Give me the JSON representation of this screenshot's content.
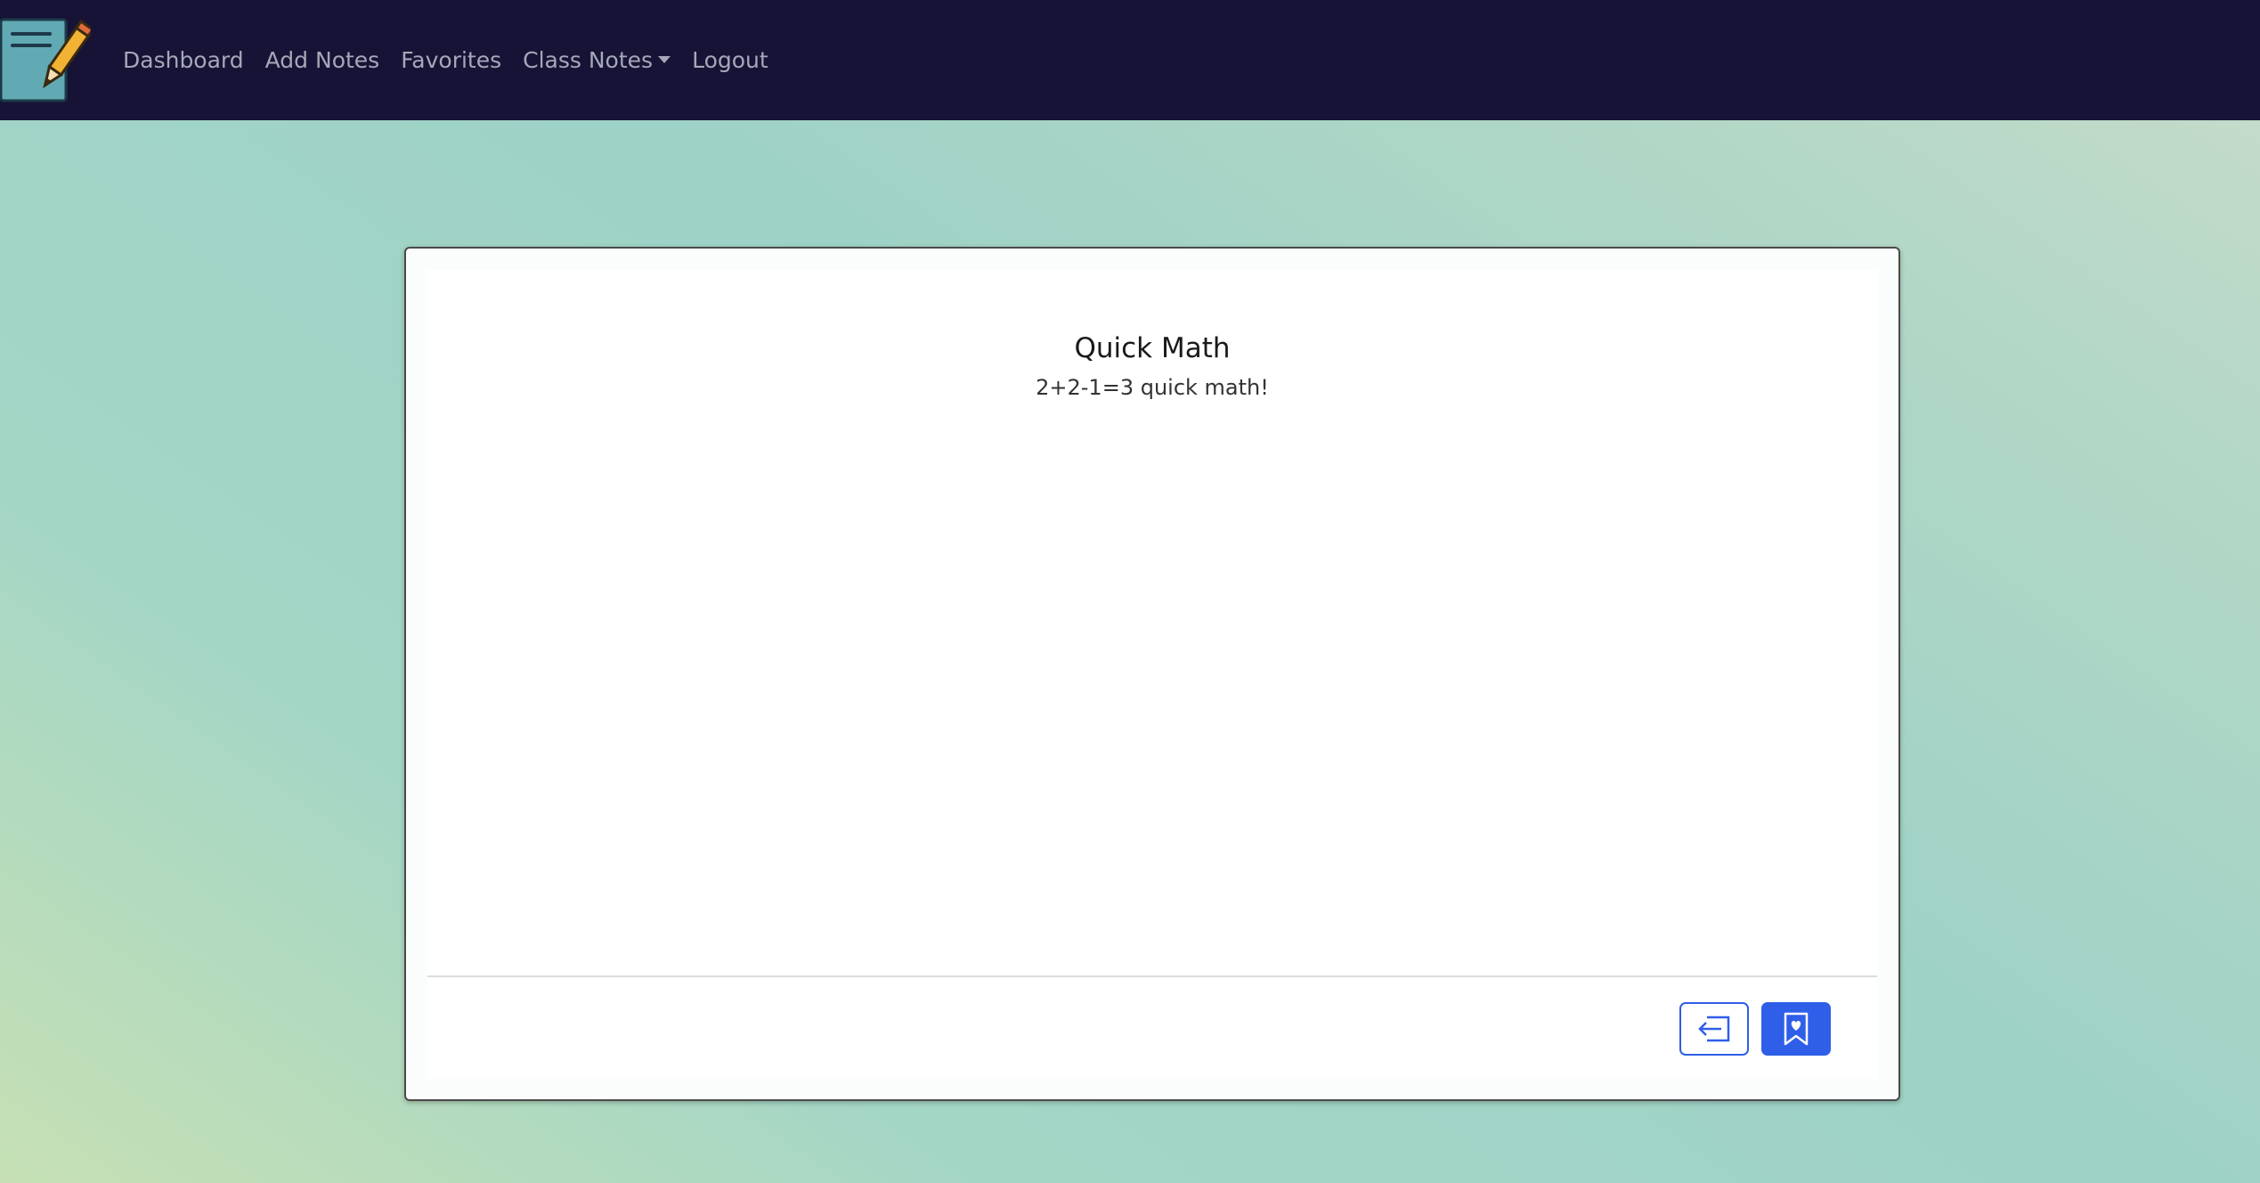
{
  "nav": {
    "brand_icon": "notepad-pencil-icon",
    "links": [
      {
        "label": "Dashboard"
      },
      {
        "label": "Add Notes"
      },
      {
        "label": "Favorites"
      },
      {
        "label": "Class Notes",
        "dropdown": true
      },
      {
        "label": "Logout"
      }
    ],
    "colors": {
      "background": "#171336",
      "link": "#a4a8b8"
    }
  },
  "note": {
    "title": "Quick Math",
    "body": "2+2-1=3 quick math!"
  },
  "actions": {
    "back_icon": "back-arrow-icon",
    "favorite_icon": "bookmark-heart-icon",
    "accent": "#2f5fe8"
  }
}
